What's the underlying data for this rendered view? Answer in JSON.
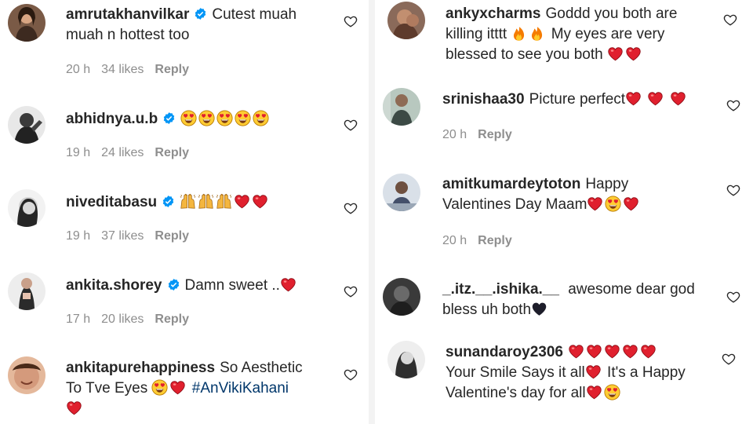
{
  "left": [
    {
      "username": "amrutakhanvilkar",
      "verified": true,
      "line1": "Cutest muah",
      "line2": "muah n hottest too",
      "time": "20 h",
      "likes": "34 likes",
      "reply": "Reply"
    },
    {
      "username": "abhidnya.u.b",
      "verified": true,
      "emoji": [
        "heart-eyes",
        "heart-eyes",
        "heart-eyes",
        "heart-eyes",
        "heart-eyes"
      ],
      "time": "19 h",
      "likes": "24 likes",
      "reply": "Reply"
    },
    {
      "username": "niveditabasu",
      "verified": true,
      "emoji": [
        "raised-hands",
        "raised-hands",
        "raised-hands",
        "red-heart",
        "red-heart"
      ],
      "time": "19 h",
      "likes": "37 likes",
      "reply": "Reply"
    },
    {
      "username": "ankita.shorey",
      "verified": true,
      "text": "Damn sweet ..",
      "time": "17 h",
      "likes": "20 likes",
      "reply": "Reply"
    },
    {
      "username": "ankitapurehappiness",
      "verified": false,
      "line1": "So Aesthetic",
      "line2": "To Tve Eyes",
      "hashtag": "#AnVikiKahani"
    }
  ],
  "right": [
    {
      "username": "ankyxcharms",
      "line1": "Goddd you both are",
      "line2": "killing itttt",
      "line2b": "My eyes are very",
      "line3": "blessed to see you both"
    },
    {
      "username": "srinishaa30",
      "text": "Picture perfect",
      "time": "20 h",
      "reply": "Reply"
    },
    {
      "username": "amitkumardeytoton",
      "line1": "Happy",
      "line2": "Valentines Day Maam",
      "time": "20 h",
      "reply": "Reply"
    },
    {
      "username": "_.itz.__.ishika.__",
      "line1": "awesome dear god",
      "line2": "bless uh both"
    },
    {
      "username": "sunandaroy2306",
      "line2": "Your Smile Says it all",
      "line2b": "It's a Happy",
      "line3": "Valentine's day for all"
    }
  ],
  "colors": {
    "text": "#262626",
    "meta": "#8e8e8e",
    "verified": "#0095f6",
    "hashtag": "#00376b",
    "heart_emoji": "#e0202e"
  },
  "icons": {
    "like": "heart-outline-icon",
    "verified": "verified-badge-icon"
  }
}
